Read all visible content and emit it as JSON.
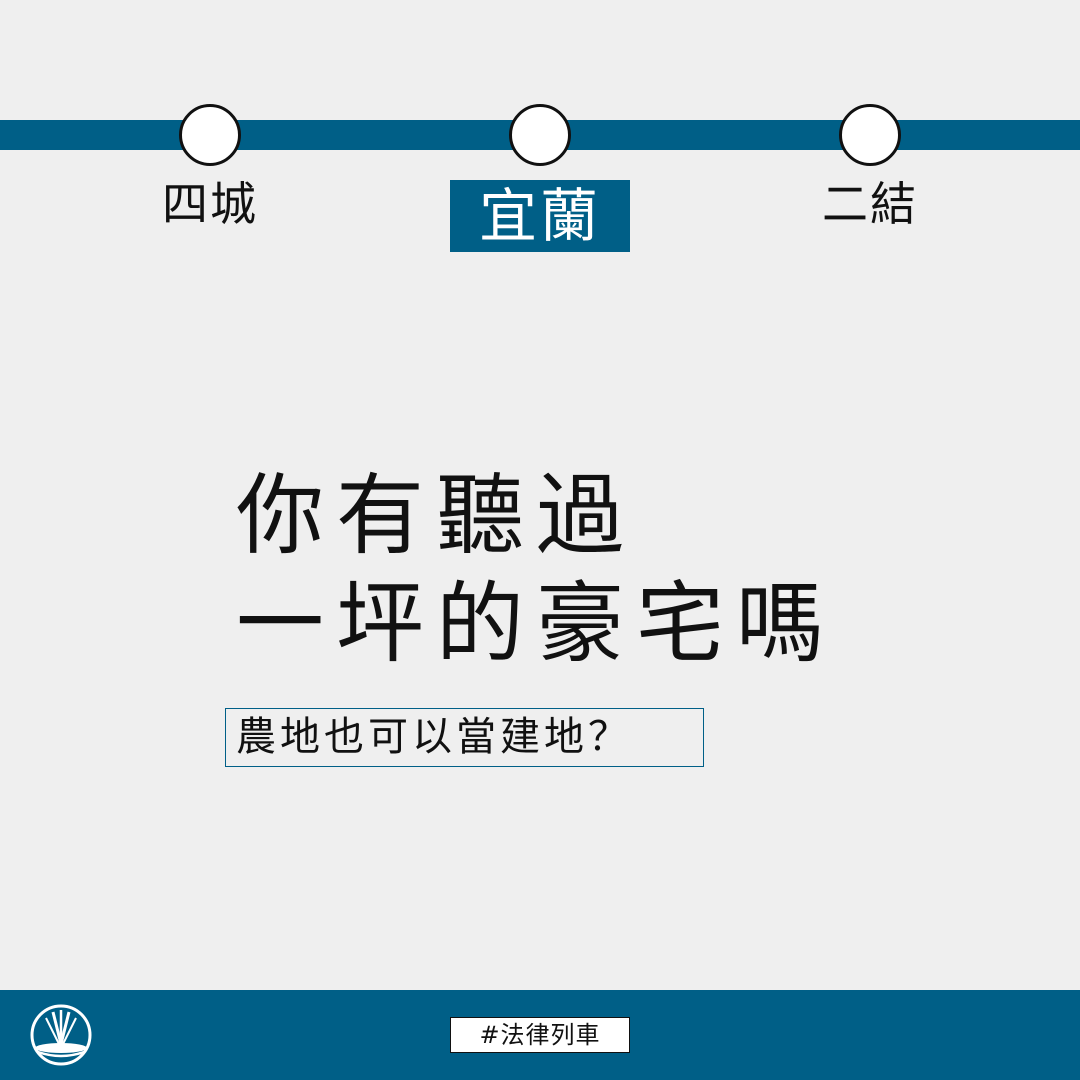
{
  "metro": {
    "line_color": "#005f87",
    "stations": [
      {
        "name": "四城",
        "current": false
      },
      {
        "name": "宜蘭",
        "current": true
      },
      {
        "name": "二結",
        "current": false
      }
    ]
  },
  "headline": {
    "line1": "你有聽過",
    "line2": "一坪的豪宅嗎"
  },
  "subtitle": "農地也可以當建地？",
  "footer": {
    "hashtag": "#法律列車",
    "logo_icon": "compass-pen-logo-icon"
  }
}
